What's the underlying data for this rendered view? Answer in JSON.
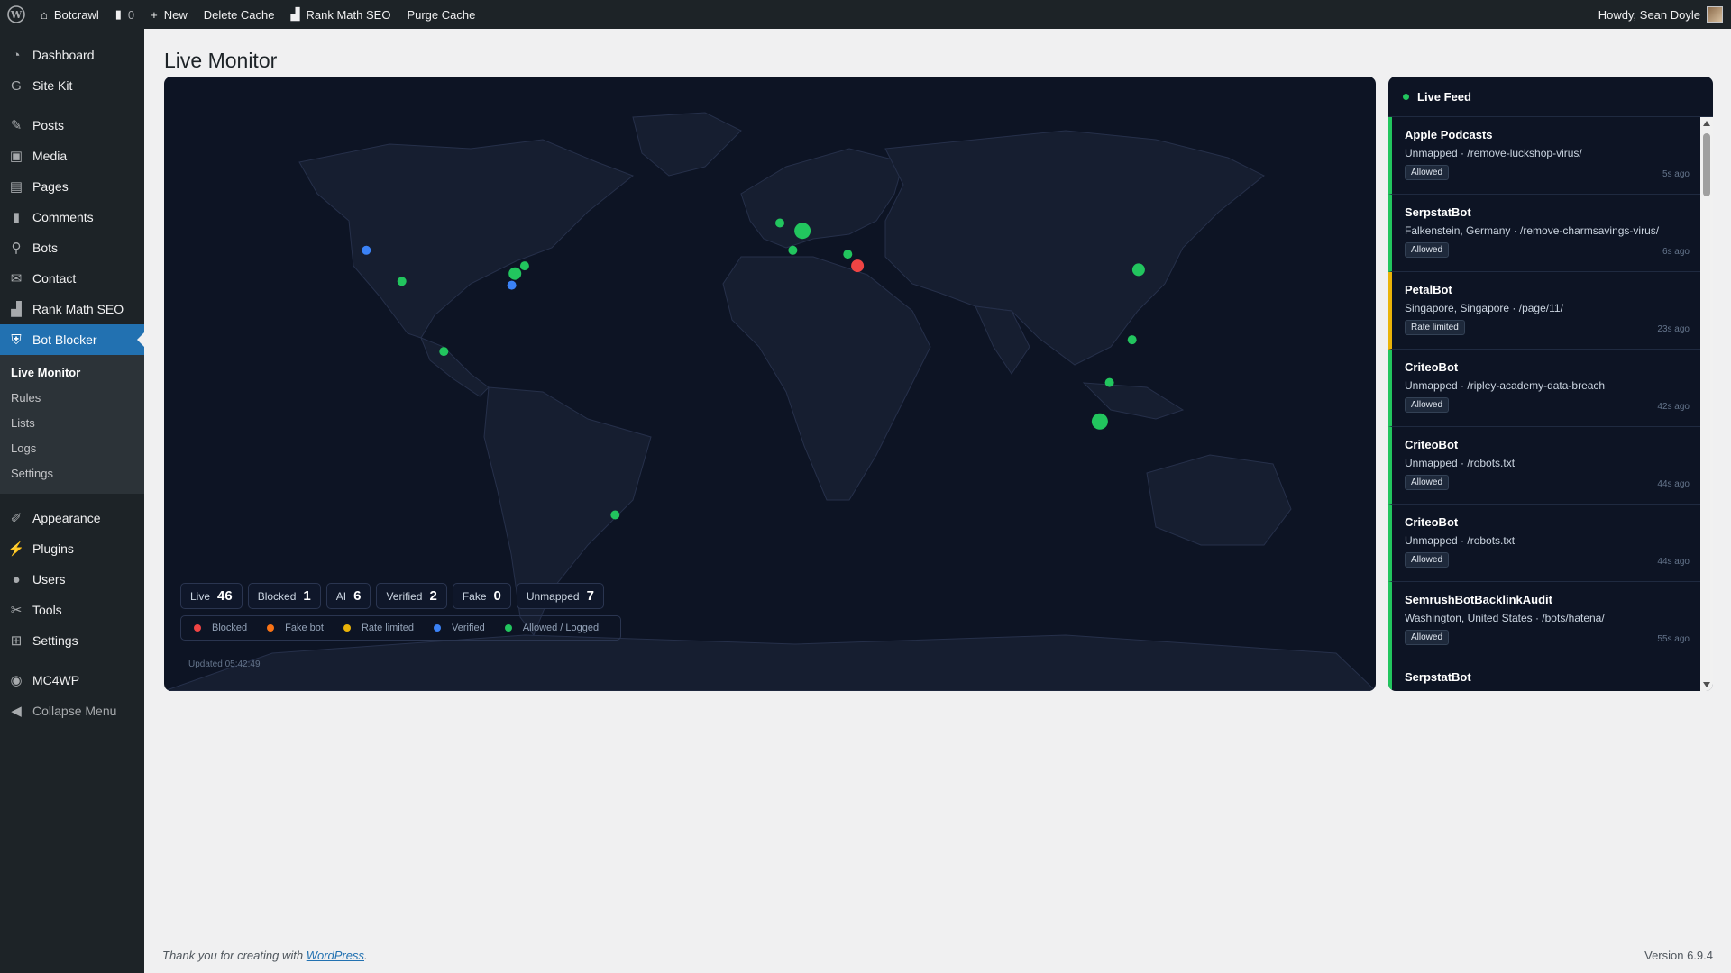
{
  "adminbar": {
    "site_name": "Botcrawl",
    "comments_count": "0",
    "new_label": "New",
    "delete_cache_label": "Delete Cache",
    "rank_math_label": "Rank Math SEO",
    "purge_cache_label": "Purge Cache",
    "howdy": "Howdy, Sean Doyle"
  },
  "sidebar": {
    "items": [
      {
        "label": "Dashboard",
        "icon": "dashboard-icon"
      },
      {
        "label": "Site Kit",
        "icon": "sitekit-icon"
      },
      {
        "label": "Posts",
        "icon": "pin-icon"
      },
      {
        "label": "Media",
        "icon": "media-icon"
      },
      {
        "label": "Pages",
        "icon": "pages-icon"
      },
      {
        "label": "Comments",
        "icon": "comment-icon"
      },
      {
        "label": "Bots",
        "icon": "search-icon"
      },
      {
        "label": "Contact",
        "icon": "mail-icon"
      },
      {
        "label": "Rank Math SEO",
        "icon": "chart-icon"
      },
      {
        "label": "Bot Blocker",
        "icon": "shield-icon"
      },
      {
        "label": "Appearance",
        "icon": "brush-icon"
      },
      {
        "label": "Plugins",
        "icon": "plugin-icon"
      },
      {
        "label": "Users",
        "icon": "user-icon"
      },
      {
        "label": "Tools",
        "icon": "wrench-icon"
      },
      {
        "label": "Settings",
        "icon": "settings-icon"
      },
      {
        "label": "MC4WP",
        "icon": "mc4wp-icon"
      }
    ],
    "submenu": [
      "Live Monitor",
      "Rules",
      "Lists",
      "Logs",
      "Settings"
    ],
    "collapse_label": "Collapse Menu"
  },
  "page": {
    "title": "Live Monitor"
  },
  "stats": [
    {
      "label": "Live",
      "value": "46"
    },
    {
      "label": "Blocked",
      "value": "1"
    },
    {
      "label": "AI",
      "value": "6"
    },
    {
      "label": "Verified",
      "value": "2"
    },
    {
      "label": "Fake",
      "value": "0"
    },
    {
      "label": "Unmapped",
      "value": "7"
    }
  ],
  "legend": [
    {
      "label": "Blocked",
      "color": "#ef4444"
    },
    {
      "label": "Fake bot",
      "color": "#f97316"
    },
    {
      "label": "Rate limited",
      "color": "#eab308"
    },
    {
      "label": "Verified",
      "color": "#3b82f6"
    },
    {
      "label": "Allowed / Logged",
      "color": "#22c55e"
    }
  ],
  "updated": "Updated 05:42:49",
  "map_points": [
    {
      "status": "verified",
      "lon": -123,
      "lat": 45,
      "weight": 1
    },
    {
      "status": "allowed",
      "lon": -112,
      "lat": 37,
      "weight": 1
    },
    {
      "status": "allowed",
      "lon": -77,
      "lat": 39,
      "weight": 2
    },
    {
      "status": "allowed",
      "lon": -74,
      "lat": 41,
      "weight": 1
    },
    {
      "status": "verified",
      "lon": -78,
      "lat": 36,
      "weight": 1
    },
    {
      "status": "allowed",
      "lon": -99,
      "lat": 19,
      "weight": 1
    },
    {
      "status": "allowed",
      "lon": -46,
      "lat": -23,
      "weight": 1
    },
    {
      "status": "allowed",
      "lon": 5,
      "lat": 52,
      "weight": 1
    },
    {
      "status": "allowed",
      "lon": 12,
      "lat": 50,
      "weight": 3
    },
    {
      "status": "allowed",
      "lon": 9,
      "lat": 45,
      "weight": 1
    },
    {
      "status": "allowed",
      "lon": 26,
      "lat": 44,
      "weight": 1
    },
    {
      "status": "blocked",
      "lon": 29,
      "lat": 41,
      "weight": 2
    },
    {
      "status": "allowed",
      "lon": 116,
      "lat": 40,
      "weight": 2
    },
    {
      "status": "allowed",
      "lon": 114,
      "lat": 22,
      "weight": 1
    },
    {
      "status": "allowed",
      "lon": 107,
      "lat": 11,
      "weight": 1
    },
    {
      "status": "allowed",
      "lon": 104,
      "lat": 1,
      "weight": 3
    }
  ],
  "feed": {
    "title": "Live Feed",
    "items": [
      {
        "name": "Apple Podcasts",
        "meta": "Unmapped · /remove-luckshop-virus/",
        "badge": "Allowed",
        "time": "5s ago",
        "tone": "green"
      },
      {
        "name": "SerpstatBot",
        "meta": "Falkenstein, Germany · /remove-charmsavings-virus/",
        "badge": "Allowed",
        "time": "6s ago",
        "tone": "green"
      },
      {
        "name": "PetalBot",
        "meta": "Singapore, Singapore · /page/11/",
        "badge": "Rate limited",
        "time": "23s ago",
        "tone": "orange"
      },
      {
        "name": "CriteoBot",
        "meta": "Unmapped · /ripley-academy-data-breach",
        "badge": "Allowed",
        "time": "42s ago",
        "tone": "green"
      },
      {
        "name": "CriteoBot",
        "meta": "Unmapped · /robots.txt",
        "badge": "Allowed",
        "time": "44s ago",
        "tone": "green"
      },
      {
        "name": "CriteoBot",
        "meta": "Unmapped · /robots.txt",
        "badge": "Allowed",
        "time": "44s ago",
        "tone": "green"
      },
      {
        "name": "SemrushBotBacklinkAudit",
        "meta": "Washington, United States · /bots/hatena/",
        "badge": "Allowed",
        "time": "55s ago",
        "tone": "green"
      },
      {
        "name": "SerpstatBot",
        "meta": "",
        "badge": "",
        "time": "",
        "tone": "green"
      }
    ]
  },
  "footer": {
    "thanks_prefix": "Thank you for creating with ",
    "wordpress_link": "WordPress",
    "thanks_suffix": ".",
    "version": "Version 6.9.4"
  }
}
